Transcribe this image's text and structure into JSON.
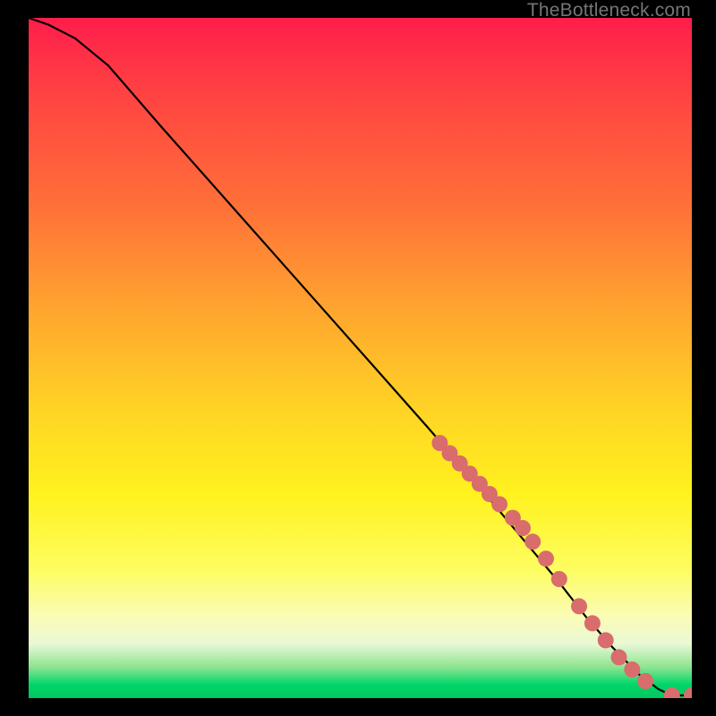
{
  "attribution": "TheBottleneck.com",
  "chart_data": {
    "type": "line",
    "title": "",
    "xlabel": "",
    "ylabel": "",
    "xlim": [
      0,
      100
    ],
    "ylim": [
      0,
      100
    ],
    "series": [
      {
        "name": "curve",
        "x": [
          0,
          3,
          7,
          12,
          20,
          30,
          40,
          50,
          60,
          68,
          74,
          80,
          84,
          88,
          92,
          95,
          97,
          100
        ],
        "y": [
          100,
          99,
          97,
          93,
          84,
          73,
          62,
          51,
          40,
          31,
          24,
          17,
          12,
          7.5,
          3.5,
          1.3,
          0.4,
          0.4
        ]
      }
    ],
    "markers": {
      "name": "highlighted-points",
      "color": "#d96c6c",
      "radius_px": 9,
      "x": [
        62,
        63.5,
        65,
        66.5,
        68,
        69.5,
        71,
        73,
        74.5,
        76,
        78,
        80,
        83,
        85,
        87,
        89,
        91,
        93,
        97,
        100
      ],
      "y": [
        37.5,
        36,
        34.5,
        33,
        31.5,
        30,
        28.5,
        26.5,
        25,
        23,
        20.5,
        17.5,
        13.5,
        11,
        8.5,
        6,
        4.2,
        2.5,
        0.4,
        0.4
      ]
    }
  }
}
